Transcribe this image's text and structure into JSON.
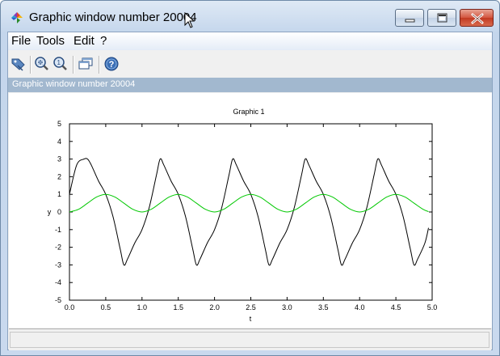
{
  "window": {
    "title": "Graphic window number 20004",
    "accent": "#c4d6ec",
    "close_color": "#c23a22"
  },
  "menu": {
    "items": [
      "File",
      "Tools",
      "Edit",
      "?"
    ]
  },
  "toolbar": {
    "icons": [
      "datatip-icon",
      "zoom-in-icon",
      "zoom-reset-icon",
      "rotate-window-icon",
      "help-icon"
    ]
  },
  "panel": {
    "header": "Graphic window number 20004",
    "header_color": "#a2b8cf"
  },
  "status": {
    "text": ""
  },
  "chart_data": {
    "type": "line",
    "title": "Graphic 1",
    "xlabel": "t",
    "ylabel": "y",
    "xlim": [
      0,
      5
    ],
    "ylim": [
      -5,
      5
    ],
    "x_ticks": [
      "0.0",
      "0.5",
      "1.0",
      "1.5",
      "2.0",
      "2.5",
      "3.0",
      "3.5",
      "4.0",
      "4.5",
      "5.0"
    ],
    "y_ticks": [
      "5",
      "4",
      "3",
      "2",
      "1",
      "0",
      "-1",
      "-2",
      "-3",
      "-4",
      "-5"
    ],
    "grid": false,
    "series": [
      {
        "color": "#000000",
        "x": [
          0,
          0.1,
          0.2,
          0.25,
          0.3,
          0.4,
          0.5,
          0.6,
          0.7,
          0.75,
          0.8,
          0.9,
          1.0,
          1.1,
          1.2,
          1.25,
          1.3,
          1.4,
          1.5,
          1.6,
          1.7,
          1.75,
          1.8,
          1.9,
          2.0,
          2.1,
          2.2,
          2.25,
          2.3,
          2.4,
          2.5,
          2.6,
          2.7,
          2.75,
          2.8,
          2.9,
          3.0,
          3.1,
          3.2,
          3.25,
          3.3,
          3.4,
          3.5,
          3.6,
          3.7,
          3.75,
          3.8,
          3.9,
          4.0,
          4.1,
          4.2,
          4.25,
          4.3,
          4.4,
          4.5,
          4.6,
          4.7,
          4.75,
          4.8,
          4.9,
          4.95
        ],
        "y": [
          1,
          2.67,
          3.0,
          3.0,
          2.67,
          1.76,
          1.0,
          -0.26,
          -2.11,
          -3.0,
          -2.67,
          -1.76,
          -1.0,
          0.26,
          2.11,
          3.0,
          2.67,
          1.76,
          1.0,
          -0.26,
          -2.11,
          -3.0,
          -2.67,
          -1.76,
          -1.0,
          0.26,
          2.11,
          3.0,
          2.67,
          1.76,
          1.0,
          -0.26,
          -2.11,
          -3.0,
          -2.67,
          -1.76,
          -1.0,
          0.26,
          2.11,
          3.0,
          2.67,
          1.76,
          1.0,
          -0.26,
          -2.11,
          -3.0,
          -2.67,
          -1.76,
          -1.0,
          0.26,
          2.11,
          3.0,
          2.67,
          1.76,
          1.0,
          -0.26,
          -2.11,
          -3.0,
          -2.67,
          -1.76,
          -0.9
        ]
      },
      {
        "color": "#00c800",
        "x": [
          0,
          0.125,
          0.25,
          0.375,
          0.5,
          0.625,
          0.75,
          0.875,
          1.0,
          1.125,
          1.25,
          1.375,
          1.5,
          1.625,
          1.75,
          1.875,
          2.0,
          2.125,
          2.25,
          2.375,
          2.5,
          2.625,
          2.75,
          2.875,
          3.0,
          3.125,
          3.25,
          3.375,
          3.5,
          3.625,
          3.75,
          3.875,
          4.0,
          4.125,
          4.25,
          4.375,
          4.5,
          4.625,
          4.75,
          4.875,
          4.95
        ],
        "y": [
          0,
          0.15,
          0.5,
          0.85,
          1.0,
          0.85,
          0.5,
          0.15,
          0,
          0.15,
          0.5,
          0.85,
          1.0,
          0.85,
          0.5,
          0.15,
          0,
          0.15,
          0.5,
          0.85,
          1.0,
          0.85,
          0.5,
          0.15,
          0,
          0.15,
          0.5,
          0.85,
          1.0,
          0.85,
          0.5,
          0.15,
          0,
          0.15,
          0.5,
          0.85,
          1.0,
          0.85,
          0.5,
          0.15,
          0.02
        ]
      }
    ]
  }
}
